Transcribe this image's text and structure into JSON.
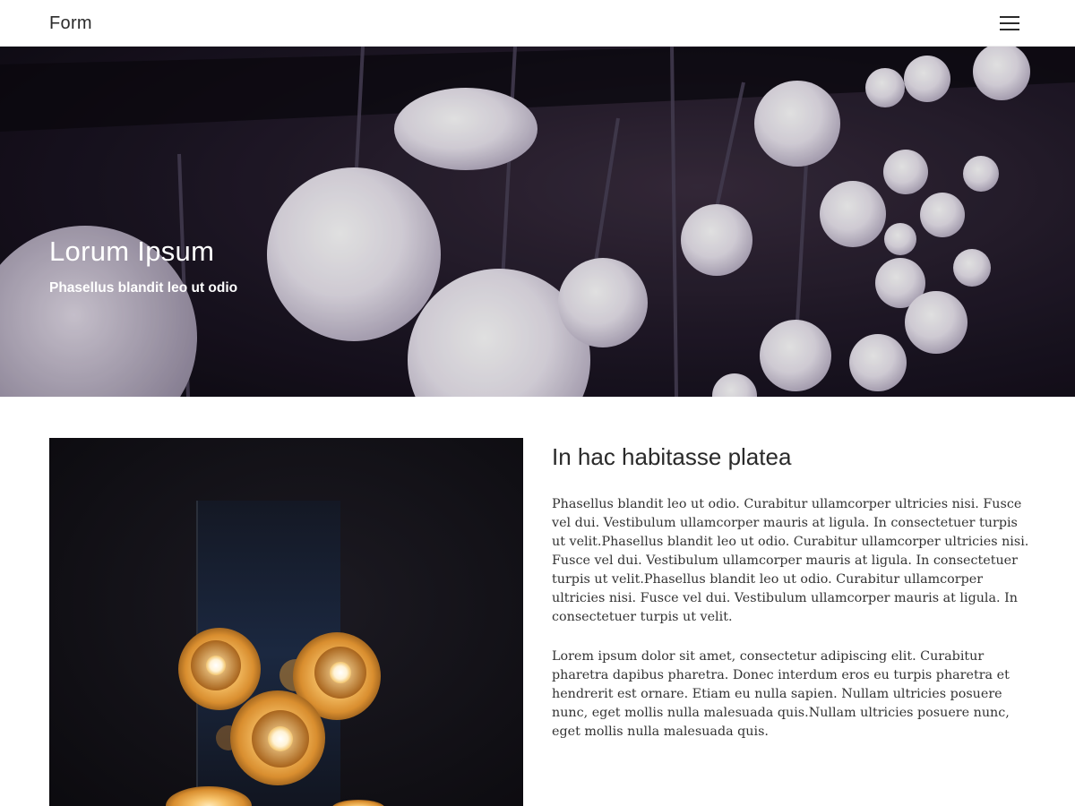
{
  "header": {
    "brand": "Form",
    "menu_icon": "hamburger-menu-icon"
  },
  "hero": {
    "title": "Lorum Ipsum",
    "subtitle": "Phasellus blandit leo ut odio",
    "background_image": "hanging-globe-lights-photo"
  },
  "main": {
    "image": "glowing-pendant-lamps-photo",
    "heading": "In hac habitasse platea",
    "paragraphs": [
      "Phasellus blandit leo ut odio. Curabitur ullamcorper ultricies nisi. Fusce vel dui. Vestibulum ullamcorper mauris at ligula. In consectetuer turpis ut velit.Phasellus blandit leo ut odio. Curabitur ullamcorper ultricies nisi. Fusce vel dui. Vestibulum ullamcorper mauris at ligula. In consectetuer turpis ut velit.Phasellus blandit leo ut odio. Curabitur ullamcorper ultricies nisi. Fusce vel dui. Vestibulum ullamcorper mauris at ligula. In consectetuer turpis ut velit.",
      "Lorem ipsum dolor sit amet, consectetur adipiscing elit. Curabitur pharetra dapibus pharetra. Donec interdum eros eu turpis pharetra et hendrerit est ornare. Etiam eu nulla sapien. Nullam ultricies posuere nunc, eget mollis nulla malesuada quis.Nullam ultricies posuere nunc, eget mollis nulla malesuada quis."
    ]
  },
  "colors": {
    "text": "#2a2a2a",
    "hero_bg": "#1a1422",
    "globe": "#ece8f2",
    "lamp_glow": "#f3b451"
  }
}
